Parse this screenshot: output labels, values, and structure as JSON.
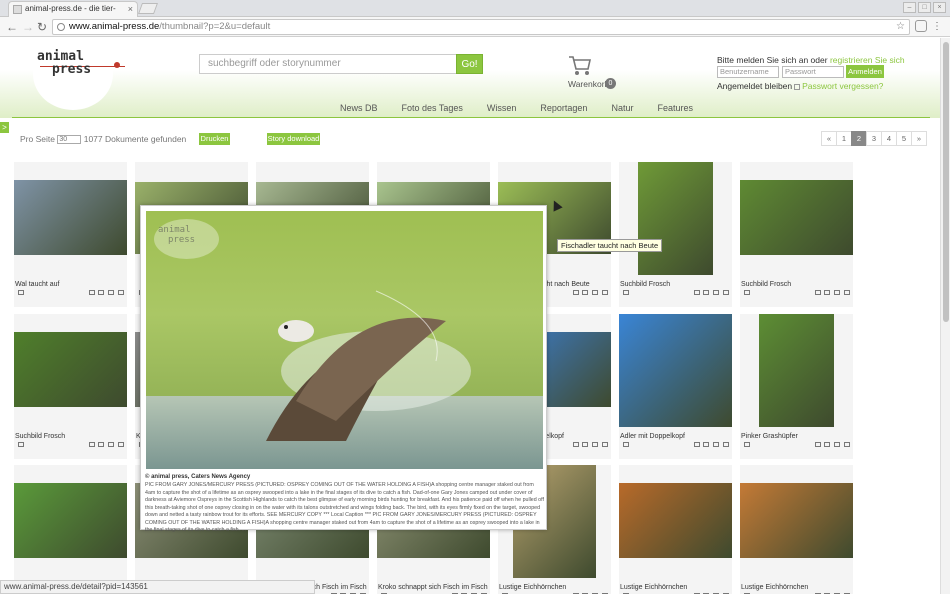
{
  "browser": {
    "tab_title": "animal-press.de - die tier-",
    "url_host": "www.animal-press.de",
    "url_path": "/thumbnail?p=2&u=default",
    "status_url": "www.animal-press.de/detail?pid=143561"
  },
  "header": {
    "logo_line1": "animal",
    "logo_line2": "press",
    "search_placeholder": "suchbegriff oder storynummer",
    "go_label": "Go!",
    "cart_label": "Warenkorb",
    "cart_count": "0",
    "login_hint": "Bitte melden Sie sich an oder ",
    "register_link": "registrieren Sie sich",
    "username_placeholder": "Benutzername",
    "password_placeholder": "Passwort",
    "login_button": "Anmelden",
    "remember_label": "Angemeldet bleiben",
    "forgot_link": "Passwort vergessen?"
  },
  "menu": [
    "News DB",
    "Foto des Tages",
    "Wissen",
    "Reportagen",
    "Natur",
    "Features"
  ],
  "toolbar": {
    "per_page_label": "Pro Seite",
    "per_page_value": "30",
    "docs_found": "1077 Dokumente gefunden",
    "print_button": "Drucken",
    "story_button": "Story download"
  },
  "pager": [
    "«",
    "1",
    "2",
    "3",
    "4",
    "5",
    "»"
  ],
  "pager_active": "2",
  "grid": [
    {
      "caption": "Wal taucht auf",
      "color": "#7f93a6"
    },
    {
      "caption": "",
      "color": "#9ab16a"
    },
    {
      "caption": "",
      "color": "#a7b892"
    },
    {
      "caption": "",
      "color": "#a9c48e"
    },
    {
      "caption": "Fischadler taucht nach Beute",
      "color": "#9bbd56"
    },
    {
      "caption": "Suchbild Frosch",
      "color": "#6f9a37"
    },
    {
      "caption": "Suchbild Frosch",
      "color": "#5f8a33"
    },
    {
      "caption": "Suchbild Frosch",
      "color": "#4f7f2b"
    },
    {
      "caption": "K",
      "color": "#8a8a8a"
    },
    {
      "caption": "",
      "color": "#9aa87d"
    },
    {
      "caption": "",
      "color": "#a0b38a"
    },
    {
      "caption": "Adler mit Doppelkopf",
      "color": "#3d7fd0"
    },
    {
      "caption": "Adler mit Doppelkopf",
      "color": "#3a85d6"
    },
    {
      "caption": "Pinker Grashüpfer",
      "color": "#5d8e34"
    },
    {
      "caption": "",
      "color": "#5a9a3a"
    },
    {
      "caption": "",
      "color": "#8b8e76"
    },
    {
      "caption": "Kroko schnappt sich Fisch im Fisch",
      "color": "#7d8a72"
    },
    {
      "caption": "Kroko schnappt sich Fisch im Fisch",
      "color": "#8d9174"
    },
    {
      "caption": "Lustige Eichhörnchen",
      "color": "#b8a36f"
    },
    {
      "caption": "Lustige Eichhörnchen",
      "color": "#b86a2a"
    },
    {
      "caption": "Lustige Eichhörnchen",
      "color": "#c47a36"
    }
  ],
  "popup": {
    "watermark_line1": "animal",
    "watermark_line2": "press",
    "credit": "© animal press, Caters News Agency",
    "description": "PIC FROM GARY JONES/MERCURY PRESS (PICTURED: OSPREY COMING OUT OF THE WATER HOLDING A FISH)A shopping centre manager staked out from 4am to capture the shot of a lifetime as an osprey swooped into a lake in the final stages of its dive to catch a fish. Dad-of-one Gary Jones camped out under cover of darkness at Aviemore Ospreys in the Scottish Highlands to catch the best glimpse of early morning birds hunting for breakfast. And his patience paid off when he pulled off this breath-taking shot of one osprey closing in on the water with its talons outstretched and wings folding back. The bird, with its eyes firmly fixed on the target, swooped down and netted a tasty rainbow trout for its efforts. SEE MERCURY COPY *** Local Caption *** PIC FROM GARY JONES/MERCURY PRESS (PICTURED: OSPREY COMING OUT OF THE WATER HOLDING A FISH)A shopping centre manager staked out from 4am to capture the shot of a lifetime as an osprey swooped into a lake in the final stages of its dive to catch a fish. ..."
  },
  "tooltip": "Fischadler taucht nach Beute",
  "colors": {
    "accent": "#8cc63f",
    "logo_red": "#c0392b"
  }
}
